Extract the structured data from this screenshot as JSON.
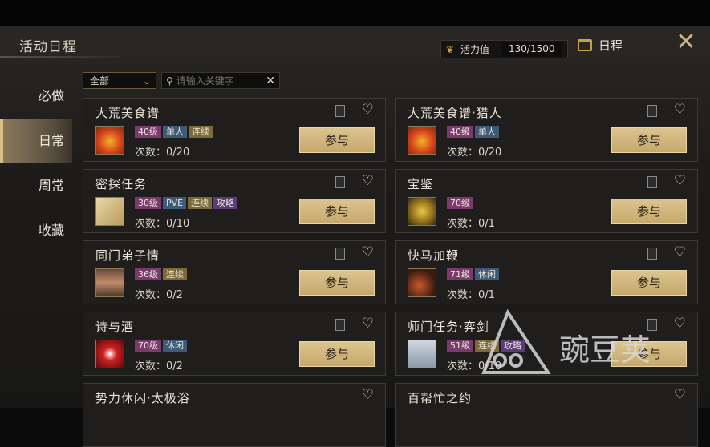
{
  "header": {
    "title": "活动日程",
    "vitality_label": "活力值",
    "vitality_value": "130/1500",
    "schedule_label": "日程",
    "close_icon": "close-icon"
  },
  "sidebar": {
    "items": [
      {
        "label": "必做"
      },
      {
        "label": "日常",
        "active": true
      },
      {
        "label": "周常"
      },
      {
        "label": "收藏"
      }
    ]
  },
  "filter": {
    "selected": "全部"
  },
  "search": {
    "placeholder": "请输入关键字"
  },
  "join_label": "参与",
  "count_prefix": "次数：",
  "cards": [
    {
      "name": "大荒美食谱",
      "tags": [
        "40级",
        "单人",
        "连续"
      ],
      "count": "0/20",
      "icon": "food-dish-icon"
    },
    {
      "name": "大荒美食谱·猎人",
      "tags": [
        "40级",
        "单人"
      ],
      "count": "0/20",
      "icon": "food-dish-icon"
    },
    {
      "name": "密探任务",
      "tags": [
        "30级",
        "PVE",
        "连续",
        "攻略"
      ],
      "count": "0/10",
      "icon": "scroll-icon"
    },
    {
      "name": "宝鉴",
      "tags": [
        "70级"
      ],
      "count": "0/1",
      "icon": "coins-icon"
    },
    {
      "name": "同门弟子情",
      "tags": [
        "36级",
        "连续"
      ],
      "count": "0/2",
      "icon": "portrait-icon"
    },
    {
      "name": "快马加鞭",
      "tags": [
        "71级",
        "休闲"
      ],
      "count": "0/1",
      "icon": "whip-icon"
    },
    {
      "name": "诗与酒",
      "tags": [
        "70级",
        "休闲"
      ],
      "count": "0/2",
      "icon": "wine-jar-icon"
    },
    {
      "name": "师门任务·弈剑",
      "tags": [
        "51级",
        "连续",
        "攻略"
      ],
      "count": "0/10",
      "icon": "pagoda-icon"
    },
    {
      "name": "势力休闲·太极浴",
      "tags": [],
      "count": "",
      "icon": ""
    },
    {
      "name": "百帮忙之约",
      "tags": [],
      "count": "",
      "icon": ""
    }
  ],
  "watermark": {
    "text": "豌豆荚"
  },
  "colors": {
    "accent_gold": "#c9a04a",
    "button": "#d4bb80",
    "tag_level": "#7a3a6e",
    "tag_blue": "#3d5a78",
    "tag_gold": "#7a6a3a",
    "tag_purple": "#5c3c78"
  }
}
